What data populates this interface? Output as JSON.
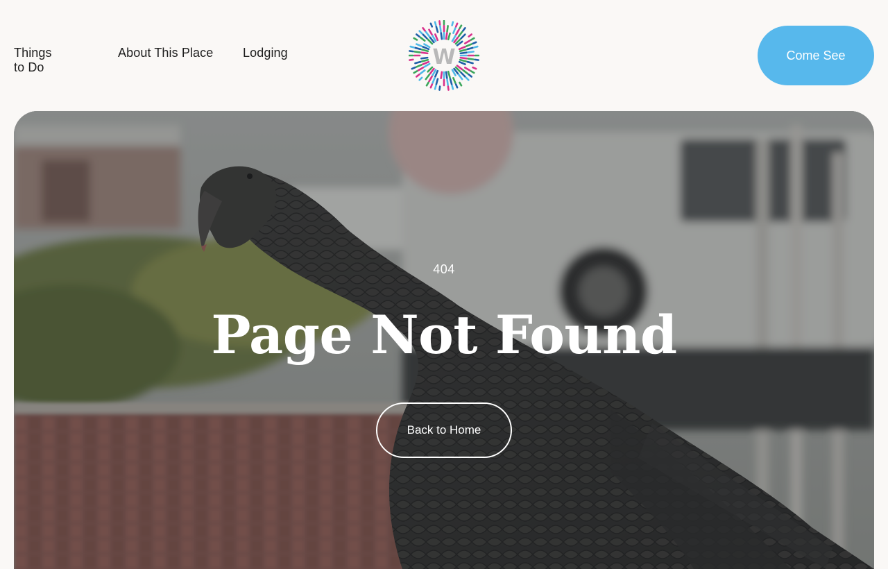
{
  "nav": {
    "items": [
      {
        "label": "Things to Do"
      },
      {
        "label": "About This Place"
      },
      {
        "label": "Lodging"
      }
    ]
  },
  "logo": {
    "letter": "W",
    "colors": [
      "#4fb9e8",
      "#d8318c",
      "#3aa65a",
      "#1f5fa8"
    ]
  },
  "cta": {
    "label": "Come See",
    "color": "#57b8ec"
  },
  "error": {
    "code": "404",
    "title": "Page Not Found",
    "button_label": "Back to Home"
  }
}
